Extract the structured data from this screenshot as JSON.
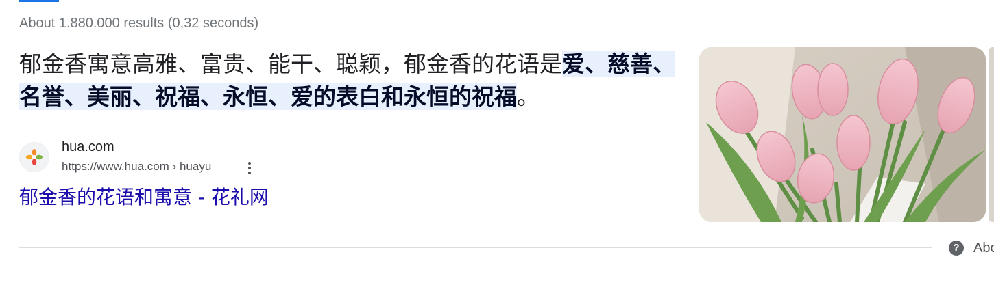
{
  "results_stats": "About 1.880.000 results (0,32 seconds)",
  "snippet": {
    "text_before": "郁金香寓意高雅、富贵、能干、聪颖，郁金香的花语是",
    "highlight": "爱、慈善、名誉、美丽、祝福、永恒、爱的表白和永恒的祝福",
    "text_after": "。"
  },
  "source": {
    "site_name": "hua.com",
    "url": "https://www.hua.com › huayu",
    "favicon_icon": "hua-flower-icon",
    "menu_icon": "more-vert-icon"
  },
  "result": {
    "title": "郁金香的花语和寓意 - 花礼网"
  },
  "thumbnail": {
    "description_icon": "tulip-bouquet-image"
  },
  "footer": {
    "help_icon_glyph": "?",
    "about_label": "Abo"
  },
  "colors": {
    "link": "#1a0dab",
    "highlight_bg": "#e8f0fe",
    "muted_text": "#70757a"
  }
}
